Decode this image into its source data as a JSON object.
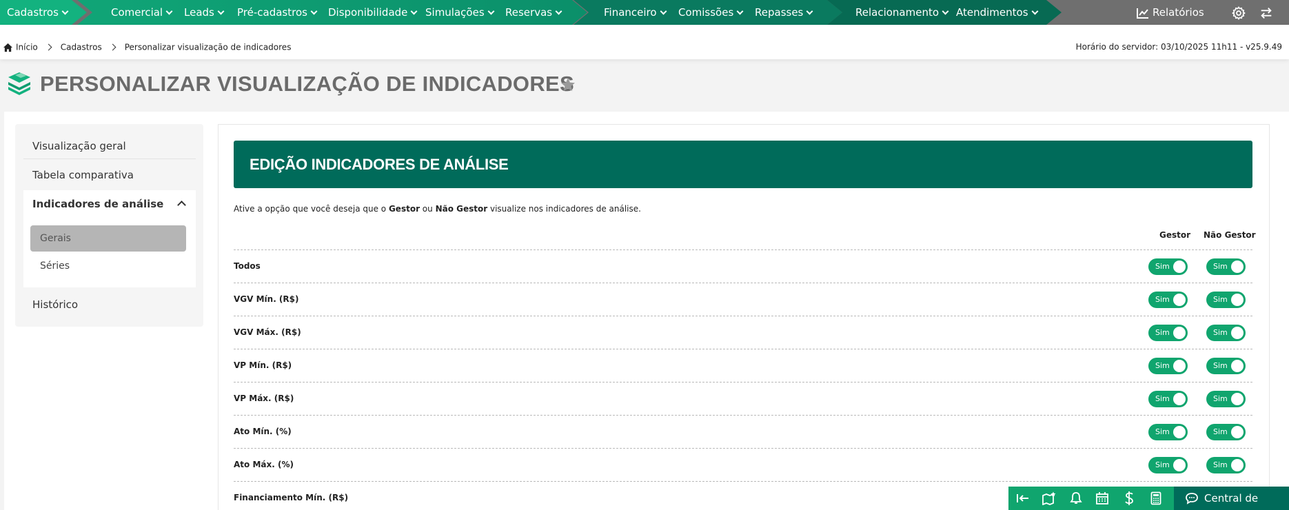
{
  "nav": {
    "items": [
      {
        "label": "Cadastros"
      },
      {
        "label": "Comercial"
      },
      {
        "label": "Leads"
      },
      {
        "label": "Pré-cadastros"
      },
      {
        "label": "Disponibilidade"
      },
      {
        "label": "Simulações"
      },
      {
        "label": "Reservas"
      },
      {
        "label": "Financeiro"
      },
      {
        "label": "Comissões"
      },
      {
        "label": "Repasses"
      },
      {
        "label": "Relacionamento"
      },
      {
        "label": "Atendimentos"
      }
    ],
    "reports_label": "Relatórios"
  },
  "breadcrumb": {
    "home": "Início",
    "level1": "Cadastros",
    "current": "Personalizar visualização de indicadores",
    "server_time": "Horário do servidor: 03/10/2025 11h11 - v25.9.49"
  },
  "page": {
    "title": "PERSONALIZAR VISUALIZAÇÃO DE INDICADORES"
  },
  "sidebar": {
    "items": [
      {
        "label": "Visualização geral"
      },
      {
        "label": "Tabela comparativa"
      },
      {
        "label": "Indicadores de análise"
      },
      {
        "label": "Histórico"
      }
    ],
    "subitems": [
      {
        "label": "Gerais",
        "active": true
      },
      {
        "label": "Séries",
        "active": false
      }
    ]
  },
  "content": {
    "banner_title": "EDIÇÃO INDICADORES DE ANÁLISE",
    "desc_prefix": "Ative a opção que você deseja que o ",
    "desc_gestor": "Gestor",
    "desc_mid": " ou ",
    "desc_nao_gestor": "Não Gestor",
    "desc_suffix": " visualize nos indicadores de análise.",
    "col_gestor": "Gestor",
    "col_nao_gestor": "Não Gestor",
    "toggle_on_label": "Sim",
    "rows": [
      {
        "label": "Todos",
        "gestor": true,
        "nao_gestor": true
      },
      {
        "label": "VGV Mín. (R$)",
        "gestor": true,
        "nao_gestor": true
      },
      {
        "label": "VGV Máx. (R$)",
        "gestor": true,
        "nao_gestor": true
      },
      {
        "label": "VP Mín. (R$)",
        "gestor": true,
        "nao_gestor": true
      },
      {
        "label": "VP Máx. (R$)",
        "gestor": true,
        "nao_gestor": true
      },
      {
        "label": "Ato Mín. (%)",
        "gestor": true,
        "nao_gestor": true
      },
      {
        "label": "Ato Máx. (%)",
        "gestor": true,
        "nao_gestor": true
      },
      {
        "label": "Financiamento Mín. (R$)",
        "gestor": null,
        "nao_gestor": null
      }
    ]
  },
  "bottom": {
    "help_label": "Central de Ajuda",
    "icons": [
      "collapse-left-icon",
      "map-star-icon",
      "bell-icon",
      "calendar-icon",
      "dollar-icon",
      "calculator-icon",
      "chat-icon"
    ]
  },
  "colors": {
    "primary_green": "#10a56e",
    "dark_green": "#006b5a",
    "nav_gray": "#6f6f6f"
  }
}
